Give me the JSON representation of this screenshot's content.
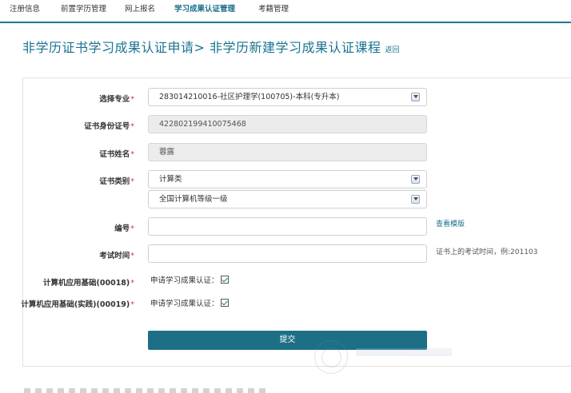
{
  "nav": {
    "items": [
      {
        "label": "注册信息"
      },
      {
        "label": "前置学历管理"
      },
      {
        "label": "网上报名"
      },
      {
        "label": "学习成果认证管理"
      },
      {
        "label": "考籍管理"
      }
    ],
    "active": "学习成果认证管理"
  },
  "heading": {
    "title": "非学历证书学习成果认证申请> 非学历新建学习成果认证课程",
    "back": "返回"
  },
  "form": {
    "major": {
      "label": "选择专业",
      "required_mark": "*",
      "value": "283014210016-社区护理学(100705)-本科(专升本)"
    },
    "id_number": {
      "label": "证书身份证号",
      "required_mark": "*",
      "value": "422802199410075468"
    },
    "name": {
      "label": "证书姓名",
      "required_mark": "*",
      "value": "蓉露"
    },
    "cert_type": {
      "label": "证书类别",
      "required_mark": "*",
      "value_primary": "计算类",
      "value_secondary": "全国计算机等级一级"
    },
    "serial": {
      "label": "编号",
      "required_mark": "*",
      "value": "",
      "hint": "查看模版"
    },
    "exam_time": {
      "label": "考试时间",
      "required_mark": "*",
      "value": "",
      "hint": "证书上的考试时间，例:201103"
    },
    "course1": {
      "label": "计算机应用基础(00018)",
      "required_mark": "*",
      "check_text": "申请学习成果认证：",
      "checked": true
    },
    "course2": {
      "label": "计算机应用基础(实践)(00019)",
      "required_mark": "*",
      "check_text": "申请学习成果认证：",
      "checked": true
    },
    "submit": "提交"
  },
  "colors": {
    "accent": "#1a7391",
    "button": "#1d6f86",
    "required": "#d23b3b"
  }
}
